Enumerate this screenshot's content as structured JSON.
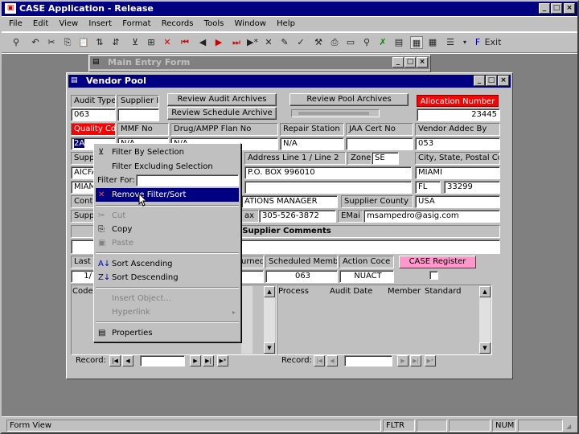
{
  "app": {
    "title": "CASE Application - Release"
  },
  "menu": [
    "File",
    "Edit",
    "View",
    "Insert",
    "Format",
    "Records",
    "Tools",
    "Window",
    "Help"
  ],
  "toolbar": {
    "exit_label": "Exit"
  },
  "main_entry": {
    "title": "Main Entry Form"
  },
  "vendor": {
    "title": "Vendor Pool",
    "labels": {
      "audit_type": "Audit Type",
      "supplier_id": "Supplier ID",
      "quality_cd": "Quality Cd",
      "mmf_no": "MMF No",
      "drug_ampp": "Drug/AMPP Flan No",
      "repair_station": "Repair Station",
      "jaa_cert": "JAA Cert No",
      "vendor_added_by": "Vendor Addec By",
      "supplier1": "Suppl",
      "address_line": "Address Line 1 / Line 2",
      "zone": "Zone",
      "city_state": "City, State, Postal Code",
      "contact": "Conta",
      "supplier_county": "Supplier County",
      "supplier2": "Suppl",
      "fax": "ax",
      "email": "EMai",
      "supplier_comments": "Supplier Comments",
      "last": "Last",
      "turned": "urned",
      "scheduled_member": "Scheduled Member",
      "action_code": "Action Coce",
      "code": "Code",
      "process": "Process",
      "audit_date": "Audit Date",
      "member": "Member",
      "standard": "Standard",
      "record": "Record:"
    },
    "buttons": {
      "review_audit": "Review Audit Archives",
      "review_schedule": "Review Schedule Archive",
      "review_pool": "Review Pool Archives",
      "allocation": "Allocation Number",
      "case_register": "CASE Register"
    },
    "values": {
      "audit_type": "063",
      "allocation_number": "23445",
      "quality_cd": "2A",
      "mmf_no": "N/A",
      "drug_ampp": "N/A",
      "repair_station": "N/A",
      "jaa_cert": "",
      "vendor_added_by": "053",
      "supplier_name": "AICFA",
      "zone": "SE",
      "address1": "P.O. BOX 996010",
      "city": "MIAMI",
      "supplier_name2": "MIAM",
      "state": "FL",
      "postal": "33299",
      "contact_title": "ATIONS MANAGER",
      "county": "USA",
      "fax": "305-526-3872",
      "email": "msampedro@asig.com",
      "last_val": "1/",
      "scheduled_member": "063",
      "action_code": "NUACT"
    }
  },
  "context_menu": {
    "filter_by_selection": "Filter By Selection",
    "filter_excluding": "Filter Excluding Selection",
    "filter_for": "Filter For:",
    "remove_filter": "Remove Filter/Sort",
    "cut": "Cut",
    "copy": "Copy",
    "paste": "Paste",
    "sort_asc": "Sort Ascending",
    "sort_desc": "Sort Descending",
    "insert_object": "Insert Object...",
    "hyperlink": "Hyperlink",
    "properties": "Properties"
  },
  "status": {
    "left": "Form View",
    "fltr": "FLTR",
    "num": "NUM"
  },
  "colors": {
    "title_active": "#000080",
    "allocation_bg": "#ff0000",
    "case_register_bg": "#ff99cc",
    "face": "#c0c0c0"
  }
}
